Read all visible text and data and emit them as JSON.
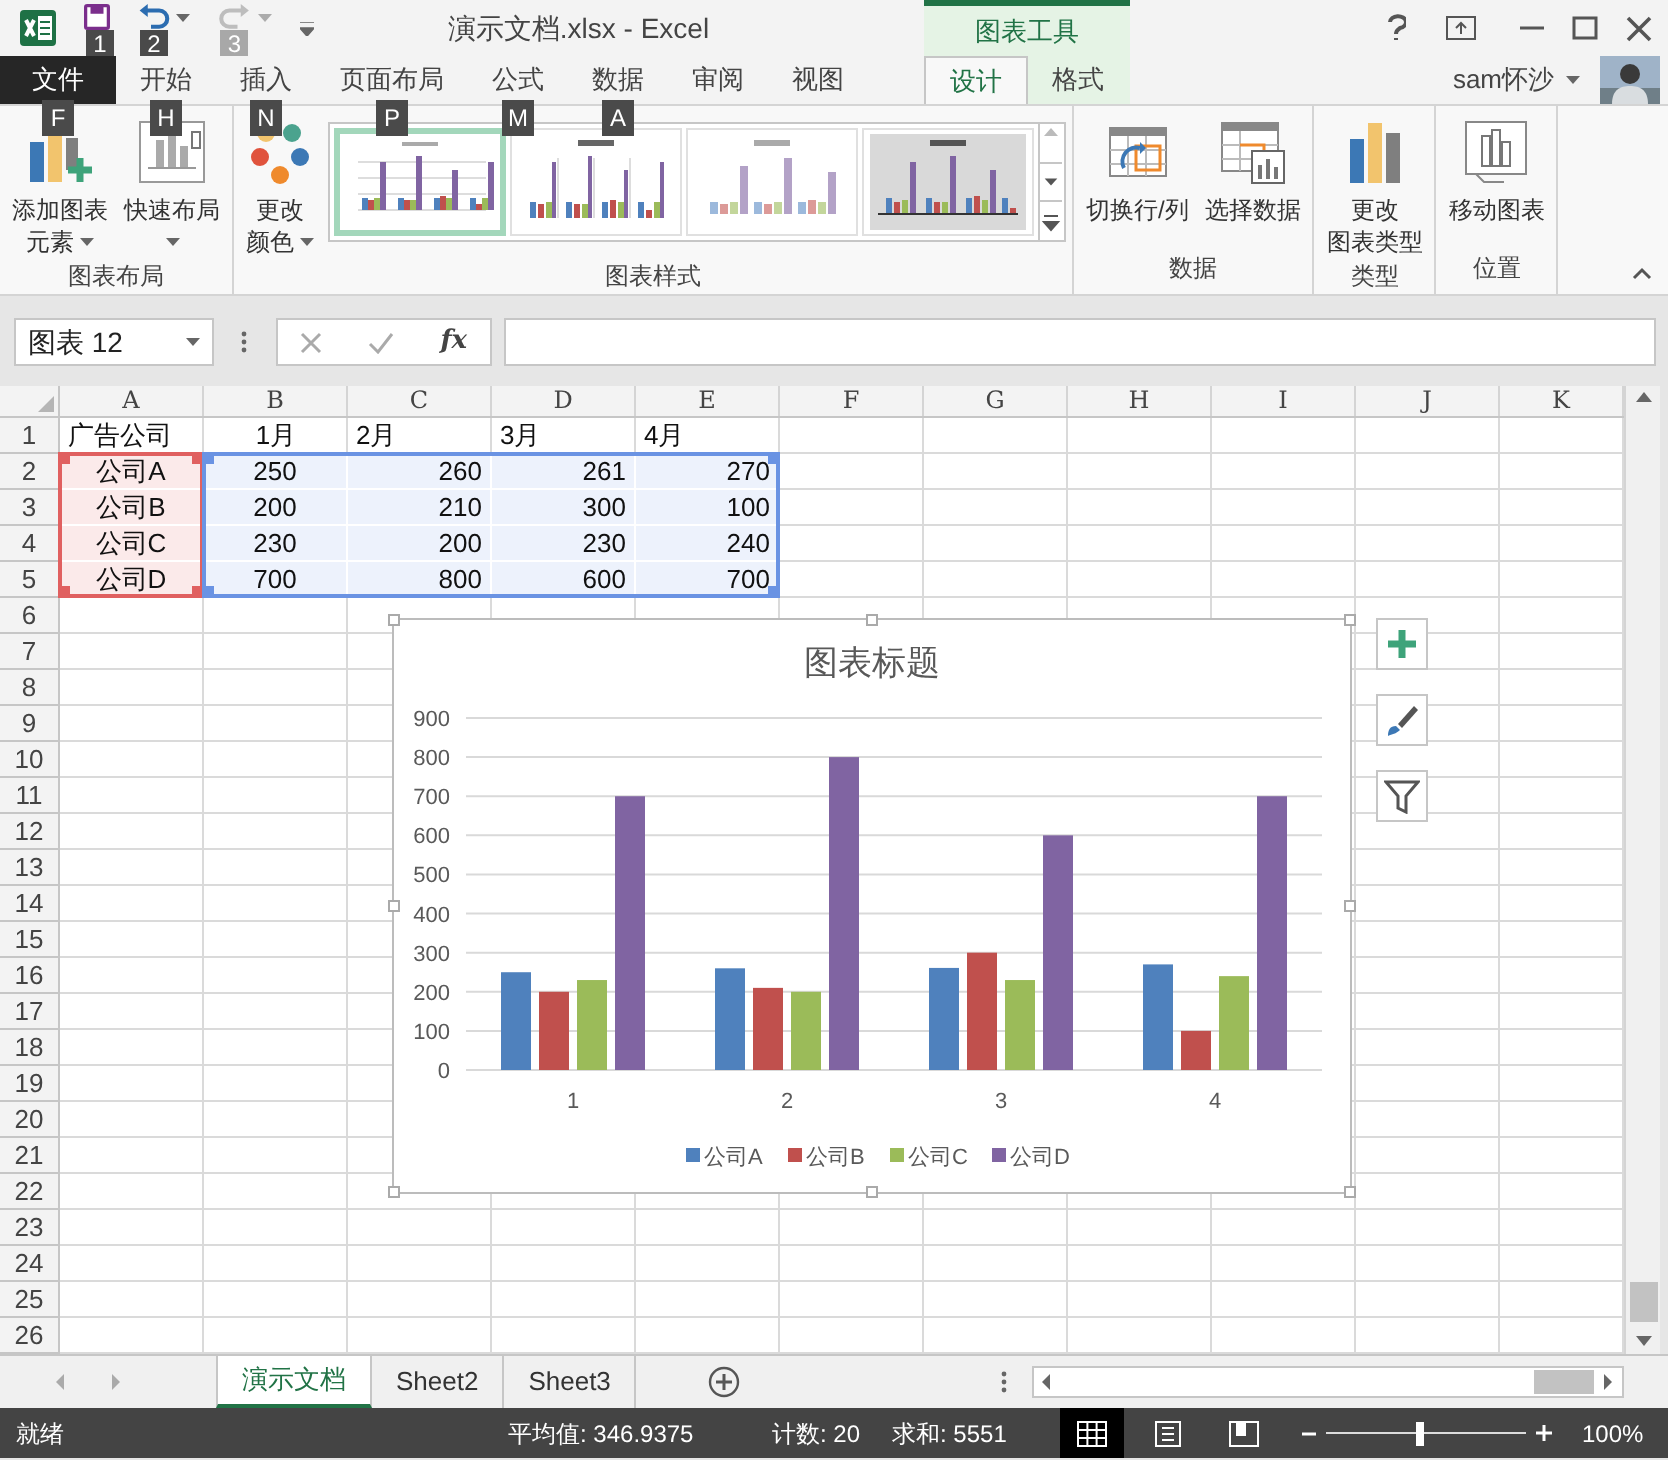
{
  "window": {
    "title": "演示文档.xlsx - Excel",
    "context_group": "图表工具",
    "user": "sam怀沙"
  },
  "quick_access": [
    {
      "kind": "save",
      "keytip": "1",
      "disabled": false
    },
    {
      "kind": "undo",
      "keytip": "2",
      "disabled": false
    },
    {
      "kind": "redo",
      "keytip": "3",
      "disabled": true
    }
  ],
  "tabs": [
    {
      "label": "文件",
      "kind": "file",
      "selected": false,
      "keytip": "F"
    },
    {
      "label": "开始",
      "kind": "normal",
      "selected": false,
      "keytip": "H"
    },
    {
      "label": "插入",
      "kind": "normal",
      "selected": false,
      "keytip": "N"
    },
    {
      "label": "页面布局",
      "kind": "normal",
      "selected": false,
      "keytip": "P"
    },
    {
      "label": "公式",
      "kind": "normal",
      "selected": false,
      "keytip": "M"
    },
    {
      "label": "数据",
      "kind": "normal",
      "selected": false,
      "keytip": "A"
    },
    {
      "label": "审阅",
      "kind": "normal",
      "selected": false
    },
    {
      "label": "视图",
      "kind": "normal",
      "selected": false
    },
    {
      "label": "设计",
      "kind": "context",
      "selected": true
    },
    {
      "label": "格式",
      "kind": "context",
      "selected": false
    }
  ],
  "ribbon_groups": [
    {
      "label": "图表布局",
      "items": [
        {
          "kind": "add_element",
          "lines": [
            "添加图表",
            "元素"
          ],
          "dropdown": true
        },
        {
          "kind": "quick_layout",
          "lines": [
            "快速布局"
          ],
          "dropdown": true
        }
      ]
    },
    {
      "label": "图表样式",
      "items": [
        {
          "kind": "change_colors",
          "lines": [
            "更改",
            "颜色"
          ],
          "dropdown": true
        },
        {
          "kind": "gallery",
          "styles": [
            {
              "kind": "plain",
              "selected": true
            },
            {
              "kind": "labeled",
              "selected": false
            },
            {
              "kind": "striped",
              "selected": false
            },
            {
              "kind": "shaded",
              "selected": false
            }
          ]
        }
      ]
    },
    {
      "label": "数据",
      "items": [
        {
          "kind": "switch",
          "lines": [
            "切换行/列"
          ]
        },
        {
          "kind": "select_data",
          "lines": [
            "选择数据"
          ]
        }
      ]
    },
    {
      "label": "类型",
      "items": [
        {
          "kind": "change_type",
          "lines": [
            "更改",
            "图表类型"
          ]
        }
      ]
    },
    {
      "label": "位置",
      "items": [
        {
          "kind": "move",
          "lines": [
            "移动图表"
          ]
        }
      ]
    }
  ],
  "name_box": "图表 12",
  "function_label": "fx",
  "columns": [
    "A",
    "B",
    "C",
    "D",
    "E",
    "F",
    "G",
    "H",
    "I",
    "J",
    "K"
  ],
  "rows": [
    {
      "header": "1",
      "cells": [
        {
          "text": "广告公司",
          "kind": "label_left"
        },
        {
          "text": "1月",
          "kind": "label_center"
        },
        {
          "text": "2月",
          "kind": "label_left"
        },
        {
          "text": "3月",
          "kind": "label_left"
        },
        {
          "text": "4月",
          "kind": "label_left"
        }
      ]
    },
    {
      "header": "2",
      "cells": [
        {
          "text": "公司A",
          "kind": "series_name"
        },
        {
          "text": "250",
          "kind": "value_center"
        },
        {
          "text": "260",
          "kind": "value_right"
        },
        {
          "text": "261",
          "kind": "value_right"
        },
        {
          "text": "270",
          "kind": "value_right"
        }
      ]
    },
    {
      "header": "3",
      "cells": [
        {
          "text": "公司B",
          "kind": "series_name"
        },
        {
          "text": "200",
          "kind": "value_center"
        },
        {
          "text": "210",
          "kind": "value_right"
        },
        {
          "text": "300",
          "kind": "value_right"
        },
        {
          "text": "100",
          "kind": "value_right"
        }
      ]
    },
    {
      "header": "4",
      "cells": [
        {
          "text": "公司C",
          "kind": "series_name"
        },
        {
          "text": "230",
          "kind": "value_center"
        },
        {
          "text": "200",
          "kind": "value_right"
        },
        {
          "text": "230",
          "kind": "value_right"
        },
        {
          "text": "240",
          "kind": "value_right"
        }
      ]
    },
    {
      "header": "5",
      "cells": [
        {
          "text": "公司D",
          "kind": "series_name"
        },
        {
          "text": "700",
          "kind": "value_center"
        },
        {
          "text": "800",
          "kind": "value_right"
        },
        {
          "text": "600",
          "kind": "value_right"
        },
        {
          "text": "700",
          "kind": "value_right"
        }
      ]
    },
    {
      "header": "6"
    },
    {
      "header": "7"
    },
    {
      "header": "8"
    },
    {
      "header": "9"
    },
    {
      "header": "10"
    },
    {
      "header": "11"
    },
    {
      "header": "12"
    },
    {
      "header": "13"
    },
    {
      "header": "14"
    },
    {
      "header": "15"
    },
    {
      "header": "16"
    },
    {
      "header": "17"
    },
    {
      "header": "18"
    },
    {
      "header": "19"
    },
    {
      "header": "20"
    },
    {
      "header": "21"
    },
    {
      "header": "22"
    },
    {
      "header": "23"
    },
    {
      "header": "24"
    },
    {
      "header": "25"
    },
    {
      "header": "26"
    }
  ],
  "chart": {
    "chart_data": {
      "type": "bar",
      "title": "图表标题",
      "categories": [
        "1",
        "2",
        "3",
        "4"
      ],
      "series": [
        {
          "name": "公司A",
          "color": "#4f81bd",
          "values": [
            250,
            260,
            261,
            270
          ]
        },
        {
          "name": "公司B",
          "color": "#c0504d",
          "values": [
            200,
            210,
            300,
            100
          ]
        },
        {
          "name": "公司C",
          "color": "#9bbb59",
          "values": [
            230,
            200,
            230,
            240
          ]
        },
        {
          "name": "公司D",
          "color": "#8064a2",
          "values": [
            700,
            800,
            600,
            700
          ]
        }
      ],
      "ylim": [
        0,
        900
      ],
      "yticks": [
        {
          "value": 0,
          "label": "0"
        },
        {
          "value": 100,
          "label": "100"
        },
        {
          "value": 200,
          "label": "200"
        },
        {
          "value": 300,
          "label": "300"
        },
        {
          "value": 400,
          "label": "400"
        },
        {
          "value": 500,
          "label": "500"
        },
        {
          "value": 600,
          "label": "600"
        },
        {
          "value": 700,
          "label": "700"
        },
        {
          "value": 800,
          "label": "800"
        },
        {
          "value": 900,
          "label": "900"
        }
      ],
      "grid": true,
      "legend": true
    },
    "tools": [
      {
        "kind": "add"
      },
      {
        "kind": "style"
      },
      {
        "kind": "filter"
      }
    ]
  },
  "sheet_tabs": [
    {
      "label": "演示文档",
      "selected": true
    },
    {
      "label": "Sheet2",
      "selected": false
    },
    {
      "label": "Sheet3",
      "selected": false
    }
  ],
  "status_bar": {
    "ready": "就绪",
    "average": "平均值: 346.9375",
    "count": "计数: 20",
    "sum": "求和: 5551",
    "views": [
      {
        "kind": "normal",
        "selected": true
      },
      {
        "kind": "page_layout",
        "selected": false
      },
      {
        "kind": "page_break",
        "selected": false
      }
    ],
    "zoom": {
      "level": 0.47,
      "label": "100%"
    }
  }
}
